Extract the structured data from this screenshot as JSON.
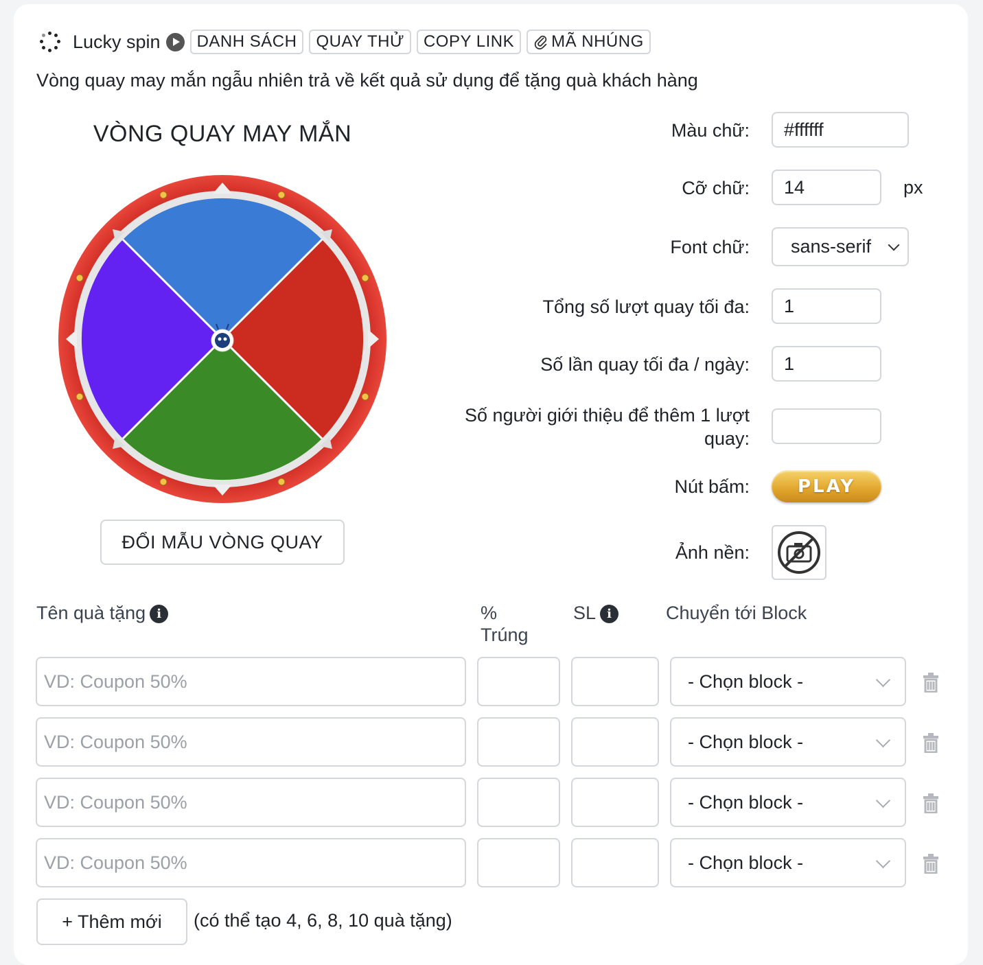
{
  "header": {
    "title": "Lucky spin",
    "buttons": {
      "list": "DANH SÁCH",
      "test": "QUAY THỬ",
      "copy_link": "COPY LINK",
      "embed": "MÃ NHÚNG"
    }
  },
  "subtitle": "Vòng quay may mắn ngẫu nhiên trả về kết quả sử dụng để tặng quà khách hàng",
  "wheel": {
    "title": "VÒNG QUAY MAY MẮN",
    "segment_colors": [
      "#3a7bd5",
      "#cc2b1f",
      "#3a8a28",
      "#6322f2"
    ],
    "rim_color": "#dd3a33",
    "change_button": "ĐỔI MẪU VÒNG QUAY"
  },
  "settings": {
    "text_color_label": "Màu chữ:",
    "text_color_value": "#ffffff",
    "font_size_label": "Cỡ chữ:",
    "font_size_value": "14",
    "font_size_unit": "px",
    "font_label": "Font chữ:",
    "font_value": "sans-serif",
    "max_spins_label": "Tổng số lượt quay tối đa:",
    "max_spins_value": "1",
    "max_per_day_label": "Số lần quay tối đa / ngày:",
    "max_per_day_value": "1",
    "referrals_label": "Số người giới thiệu để thêm 1 lượt quay:",
    "referrals_value": "",
    "button_label": "Nút bấm:",
    "button_text": "PLAY",
    "background_label": "Ảnh nền:"
  },
  "prizes": {
    "col_name": "Tên quà tặng",
    "col_percent": "% Trúng",
    "col_qty": "SL",
    "col_block": "Chuyển tới Block",
    "rows": [
      {
        "name_placeholder": "VD: Coupon 50%",
        "block": "- Chọn block -"
      },
      {
        "name_placeholder": "VD: Coupon 50%",
        "block": "- Chọn block -"
      },
      {
        "name_placeholder": "VD: Coupon 50%",
        "block": "- Chọn block -"
      },
      {
        "name_placeholder": "VD: Coupon 50%",
        "block": "- Chọn block -"
      }
    ],
    "add_button": "+ Thêm mới",
    "add_note": "(có thể tạo 4, 6, 8, 10 quà tặng)"
  }
}
